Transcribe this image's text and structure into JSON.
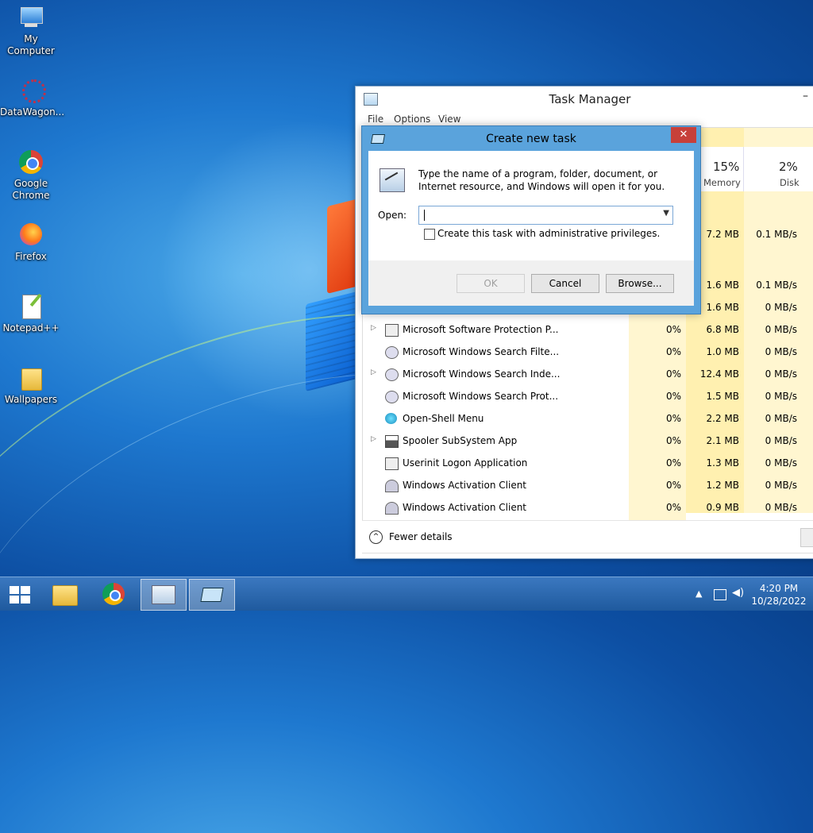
{
  "desktop": {
    "icons": [
      {
        "label": "My Computer"
      },
      {
        "label": "DataWagon..."
      },
      {
        "label": "Google Chrome"
      },
      {
        "label": "Firefox"
      },
      {
        "label": "Notepad++"
      },
      {
        "label": "Wallpapers"
      }
    ]
  },
  "task_manager": {
    "title": "Task Manager",
    "menu": [
      "File",
      "Options",
      "View"
    ],
    "columns": {
      "memory": {
        "pct": "15%",
        "label": "Memory"
      },
      "disk": {
        "pct": "2%",
        "label": "Disk"
      }
    },
    "partial_rows": [
      {
        "mem": "7.2 MB",
        "disk": "0.1 MB/s"
      },
      {
        "mem": "1.6 MB",
        "disk": "0.1 MB/s"
      },
      {
        "mem": "1.6 MB",
        "disk": "0 MB/s"
      }
    ],
    "rows": [
      {
        "name": "Microsoft Software Protection P...",
        "cpu": "0%",
        "mem": "6.8 MB",
        "disk": "0 MB/s",
        "expand": true
      },
      {
        "name": "Microsoft Windows Search Filte...",
        "cpu": "0%",
        "mem": "1.0 MB",
        "disk": "0 MB/s",
        "expand": false
      },
      {
        "name": "Microsoft Windows Search Inde...",
        "cpu": "0%",
        "mem": "12.4 MB",
        "disk": "0 MB/s",
        "expand": true
      },
      {
        "name": "Microsoft Windows Search Prot...",
        "cpu": "0%",
        "mem": "1.5 MB",
        "disk": "0 MB/s",
        "expand": false
      },
      {
        "name": "Open-Shell Menu",
        "cpu": "0%",
        "mem": "2.2 MB",
        "disk": "0 MB/s",
        "expand": false
      },
      {
        "name": "Spooler SubSystem App",
        "cpu": "0%",
        "mem": "2.1 MB",
        "disk": "0 MB/s",
        "expand": true
      },
      {
        "name": "Userinit Logon Application",
        "cpu": "0%",
        "mem": "1.3 MB",
        "disk": "0 MB/s",
        "expand": false
      },
      {
        "name": "Windows Activation Client",
        "cpu": "0%",
        "mem": "1.2 MB",
        "disk": "0 MB/s",
        "expand": false
      },
      {
        "name": "Windows Activation Client",
        "cpu": "0%",
        "mem": "0.9 MB",
        "disk": "0 MB/s",
        "expand": false
      }
    ],
    "footer": {
      "fewer_details": "Fewer details"
    }
  },
  "dialog": {
    "title": "Create new task",
    "close": "✕",
    "description": "Type the name of a program, folder, document, or Internet resource, and Windows will open it for you.",
    "open_label": "Open:",
    "open_value": "",
    "admin_label": "Create this task with administrative privileges.",
    "buttons": {
      "ok": "OK",
      "cancel": "Cancel",
      "browse": "Browse..."
    }
  },
  "taskbar": {
    "time": "4:20 PM",
    "date": "10/28/2022"
  }
}
